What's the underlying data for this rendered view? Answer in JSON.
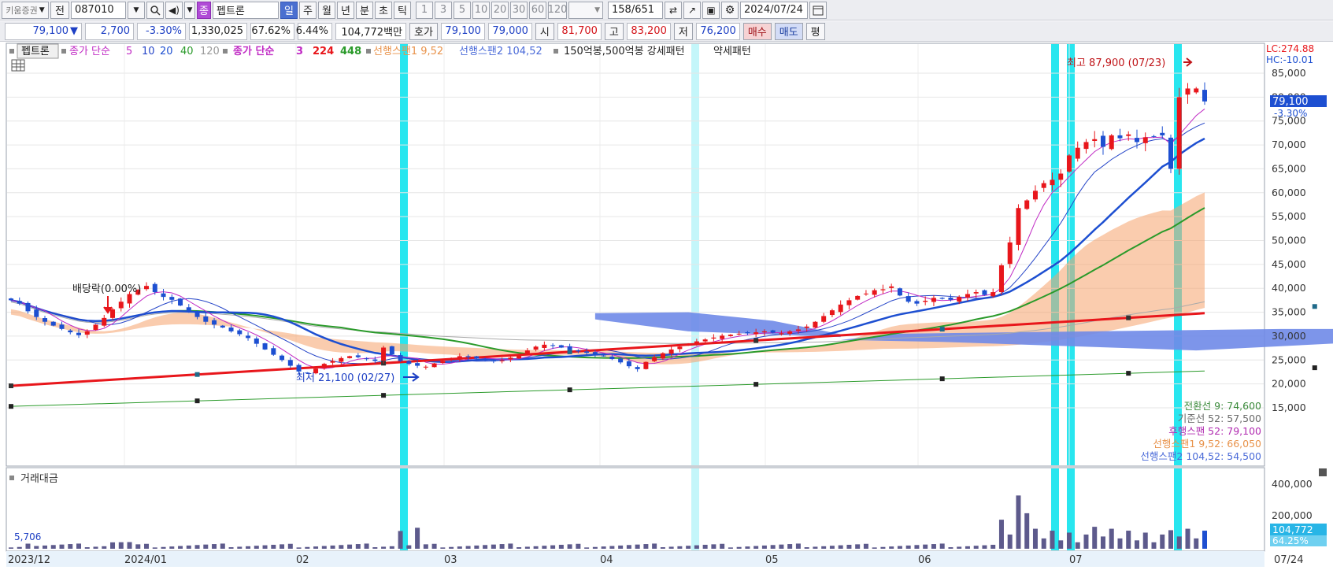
{
  "toolbar": {
    "code_label": "키움증권",
    "prev_label": "전",
    "stock_code": "087010",
    "stock_type_badge": "종",
    "stock_name": "펩트론",
    "periods": [
      "일",
      "주",
      "월",
      "년",
      "분",
      "초",
      "틱"
    ],
    "intervals": [
      "1",
      "3",
      "5",
      "10",
      "20",
      "30",
      "60",
      "120"
    ],
    "count": "158",
    "total": "/651",
    "date": "2024/07/24"
  },
  "quote": {
    "price": "79,100",
    "change": "2,700",
    "change_pct": "-3.30%",
    "volume": "1,330,025",
    "vol_ratio": "67.62%",
    "turnover_pct": "6.44%",
    "trade_amount": "104,772백만",
    "bid_label": "호가",
    "ask_price": "79,100",
    "bid_price": "79,000",
    "open_label": "시",
    "open": "81,700",
    "high_label": "고",
    "high": "83,200",
    "low_label": "저",
    "low": "76,200",
    "buy_label": "매수",
    "sell_label": "매도",
    "eval_label": "평"
  },
  "legend": {
    "name": "펩트론",
    "ma_label": "종가 단순",
    "ma_periods": [
      "5",
      "10",
      "20",
      "40",
      "120"
    ],
    "ma2_label": "종가 단순",
    "ma2_periods": [
      "3",
      "224",
      "448"
    ],
    "span1": "선행스팬1 9,52",
    "span2": "선행스팬2 104,52",
    "pattern1": "150억봉,500억봉 강세패턴",
    "pattern2": "약세패턴"
  },
  "annotations": {
    "dividend": "배당락(0.00%)",
    "max": "최고 87,900 (07/23)",
    "min": "최저 21,100 (02/27)"
  },
  "right_axis": {
    "lc": "LC:274.88",
    "hc": "HC:-10.01",
    "ticks": [
      "85,000",
      "80,000",
      "75,000",
      "70,000",
      "65,000",
      "60,000",
      "55,000",
      "50,000",
      "45,000",
      "40,000",
      "35,000",
      "30,000",
      "25,000",
      "20,000",
      "15,000"
    ],
    "current_price": "79,100",
    "current_change": "-3.30%"
  },
  "ichimoku_values": [
    {
      "label": "전환선 9: 74,600",
      "color": "#3a8a3a"
    },
    {
      "label": "기준선 52: 57,500",
      "color": "#6a6a6a"
    },
    {
      "label": "후행스팬 52: 79,100",
      "color": "#b02ab0"
    },
    {
      "label": "선행스팬1 9,52: 66,050",
      "color": "#e8924a"
    },
    {
      "label": "선행스팬2 104,52: 54,500",
      "color": "#4a6ad8"
    }
  ],
  "volume_panel": {
    "title": "거래대금",
    "first_value": "5,706",
    "ticks": [
      "400,000",
      "200,000"
    ],
    "current": "104,772",
    "current_pct": "64.25%"
  },
  "x_axis": [
    "2023/12",
    "2024/01",
    "02",
    "03",
    "04",
    "05",
    "06",
    "07",
    "07/24"
  ],
  "colors": {
    "up": "#e8161b",
    "down": "#1d4fd1",
    "cloud_pos": "#f5a36b",
    "cloud_neg": "#6f89e8",
    "highlight": "#28e6ef",
    "highlight_light": "#c4f6fa"
  },
  "chart_data": {
    "type": "candlestick",
    "title": "펩트론",
    "y_range": [
      13000,
      89000
    ],
    "max_label": {
      "value": 87900,
      "date": "07/23"
    },
    "min_label": {
      "value": 21100,
      "date": "02/27"
    },
    "closes": [
      37500,
      36800,
      35200,
      34000,
      33000,
      32200,
      31500,
      30800,
      30200,
      31000,
      32400,
      33800,
      35600,
      37200,
      38800,
      39700,
      40500,
      39200,
      38200,
      37600,
      36400,
      35200,
      34000,
      33000,
      32400,
      31800,
      31000,
      30400,
      29600,
      28400,
      27200,
      26100,
      25000,
      23800,
      22600,
      22300,
      23200,
      24200,
      24800,
      25400,
      25800,
      25600,
      25200,
      24800,
      27600,
      26200,
      24800,
      24200,
      23800,
      23600,
      24300,
      24800,
      25300,
      25800,
      25600,
      25300,
      25000,
      24700,
      24900,
      25500,
      26200,
      27000,
      27800,
      28200,
      28000,
      27600,
      27200,
      26800,
      26500,
      26200,
      25800,
      25200,
      24500,
      23700,
      23100,
      24600,
      25600,
      26400,
      27200,
      27800,
      28400,
      28900,
      29300,
      29700,
      30100,
      30300,
      30500,
      30600,
      30800,
      31000,
      30700,
      30600,
      31000,
      31400,
      32000,
      33000,
      34200,
      35400,
      36600,
      37500,
      38400,
      38900,
      39600,
      39800,
      40400,
      38500,
      37200,
      36800,
      37400,
      38000,
      37800,
      37600,
      38200,
      38800,
      39200,
      38600,
      39200,
      44800,
      49600,
      56800,
      58400,
      60400,
      62000,
      62700,
      64000,
      67800,
      69400,
      70600,
      71200,
      69600,
      72000,
      71400,
      72200,
      70600,
      71600,
      71800,
      72000,
      65000,
      80000,
      81800,
      81800,
      79100
    ]
  }
}
